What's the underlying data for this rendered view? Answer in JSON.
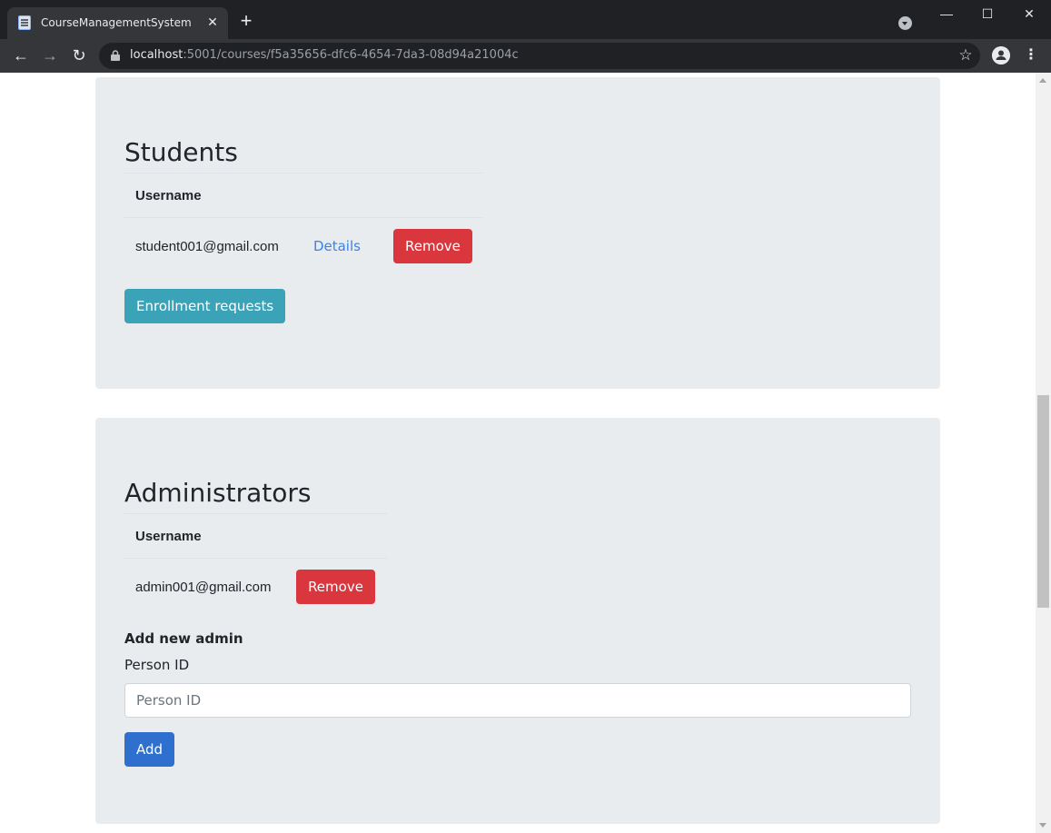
{
  "browser": {
    "tab_title": "CourseManagementSystem",
    "url_host": "localhost",
    "url_rest": ":5001/courses/f5a35656-dfc6-4654-7da3-08d94a21004c"
  },
  "students": {
    "heading": "Students",
    "column_username": "Username",
    "rows": [
      {
        "username": "student001@gmail.com",
        "details_label": "Details",
        "remove_label": "Remove"
      }
    ],
    "enrollment_requests_label": "Enrollment requests"
  },
  "administrators": {
    "heading": "Administrators",
    "column_username": "Username",
    "rows": [
      {
        "username": "admin001@gmail.com",
        "remove_label": "Remove"
      }
    ],
    "add_admin_heading": "Add new admin",
    "person_id_label": "Person ID",
    "person_id_placeholder": "Person ID",
    "person_id_value": "",
    "add_label": "Add"
  },
  "colors": {
    "danger": "#d9363e",
    "info": "#3aa3b8",
    "primary": "#2f6fce",
    "card_bg": "#e9ecef"
  }
}
